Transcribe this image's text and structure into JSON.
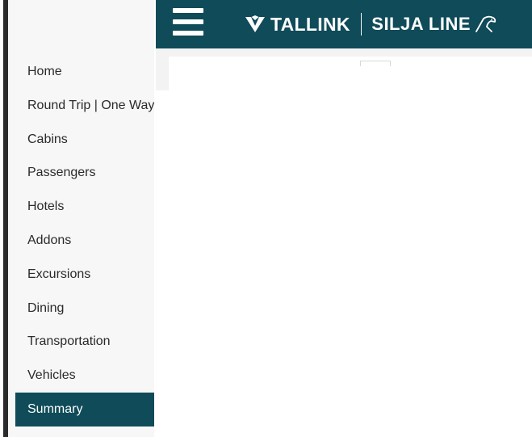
{
  "header": {
    "menu_icon": "hamburger-menu-icon",
    "brand": {
      "primary": "TALLINK",
      "secondary": "SILJA LINE",
      "primary_mark_icon": "tallink-logo-mark",
      "secondary_mark_icon": "silja-line-bird-logo"
    }
  },
  "sidebar": {
    "items": [
      {
        "label": "Home",
        "active": false
      },
      {
        "label": "Round Trip | One Way",
        "active": false
      },
      {
        "label": "Cabins",
        "active": false
      },
      {
        "label": "Passengers",
        "active": false
      },
      {
        "label": "Hotels",
        "active": false
      },
      {
        "label": "Addons",
        "active": false
      },
      {
        "label": "Excursions",
        "active": false
      },
      {
        "label": "Dining",
        "active": false
      },
      {
        "label": "Transportation",
        "active": false
      },
      {
        "label": "Vehicles",
        "active": false
      },
      {
        "label": "Summary",
        "active": true
      }
    ]
  },
  "colors": {
    "brand_dark_teal": "#0f4b58",
    "sidebar_background": "#f7f7f7",
    "text": "#2a2a2a",
    "active_text": "#ffffff"
  }
}
